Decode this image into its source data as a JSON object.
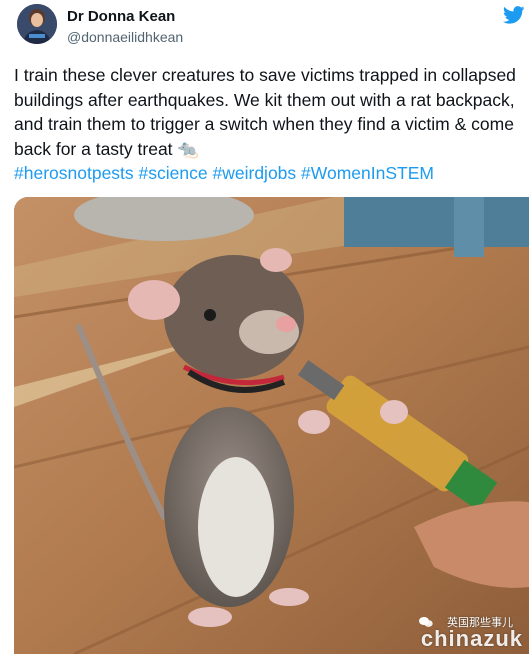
{
  "author": {
    "display_name": "Dr Donna Kean",
    "handle": "@donnaeilidhkean"
  },
  "tweet": {
    "text": "I train these clever creatures to save victims trapped in collapsed buildings after earthquakes. We kit them out with a rat backpack, and train them to trigger a switch when they find a victim & come back for a tasty treat",
    "emoji": "🐀",
    "hashtags": [
      "#herosnotpests",
      "#science",
      "#weirdjobs",
      "#WomenInSTEM"
    ]
  },
  "watermark": {
    "channel": "英国那些事儿",
    "site": "chinazuk"
  },
  "colors": {
    "link": "#1d9bf0",
    "twitter_blue": "#1d9bf0"
  }
}
